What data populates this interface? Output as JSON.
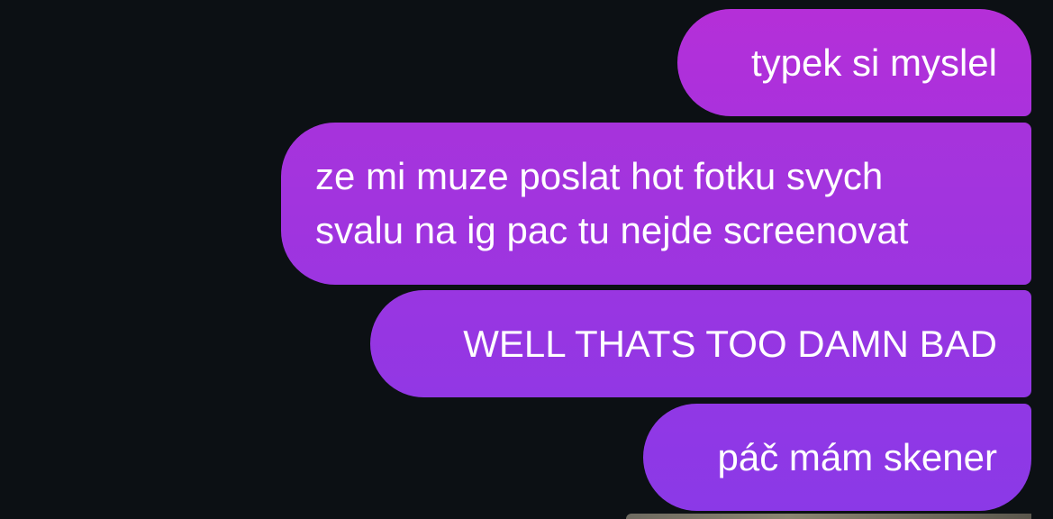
{
  "conversation": {
    "messages": [
      {
        "lines": [
          "typek si myslel"
        ]
      },
      {
        "lines": [
          "ze mi muze poslat hot fotku svych",
          "svalu na ig pac tu nejde screenovat"
        ]
      },
      {
        "lines": [
          "WELL THATS TOO DAMN BAD"
        ]
      },
      {
        "lines": [
          "páč mám skener"
        ]
      }
    ]
  },
  "colors": {
    "background": "#0c1014",
    "bubble_top": "#b52fd8",
    "bubble_bottom": "#8b39e7",
    "text": "#ffffff"
  }
}
